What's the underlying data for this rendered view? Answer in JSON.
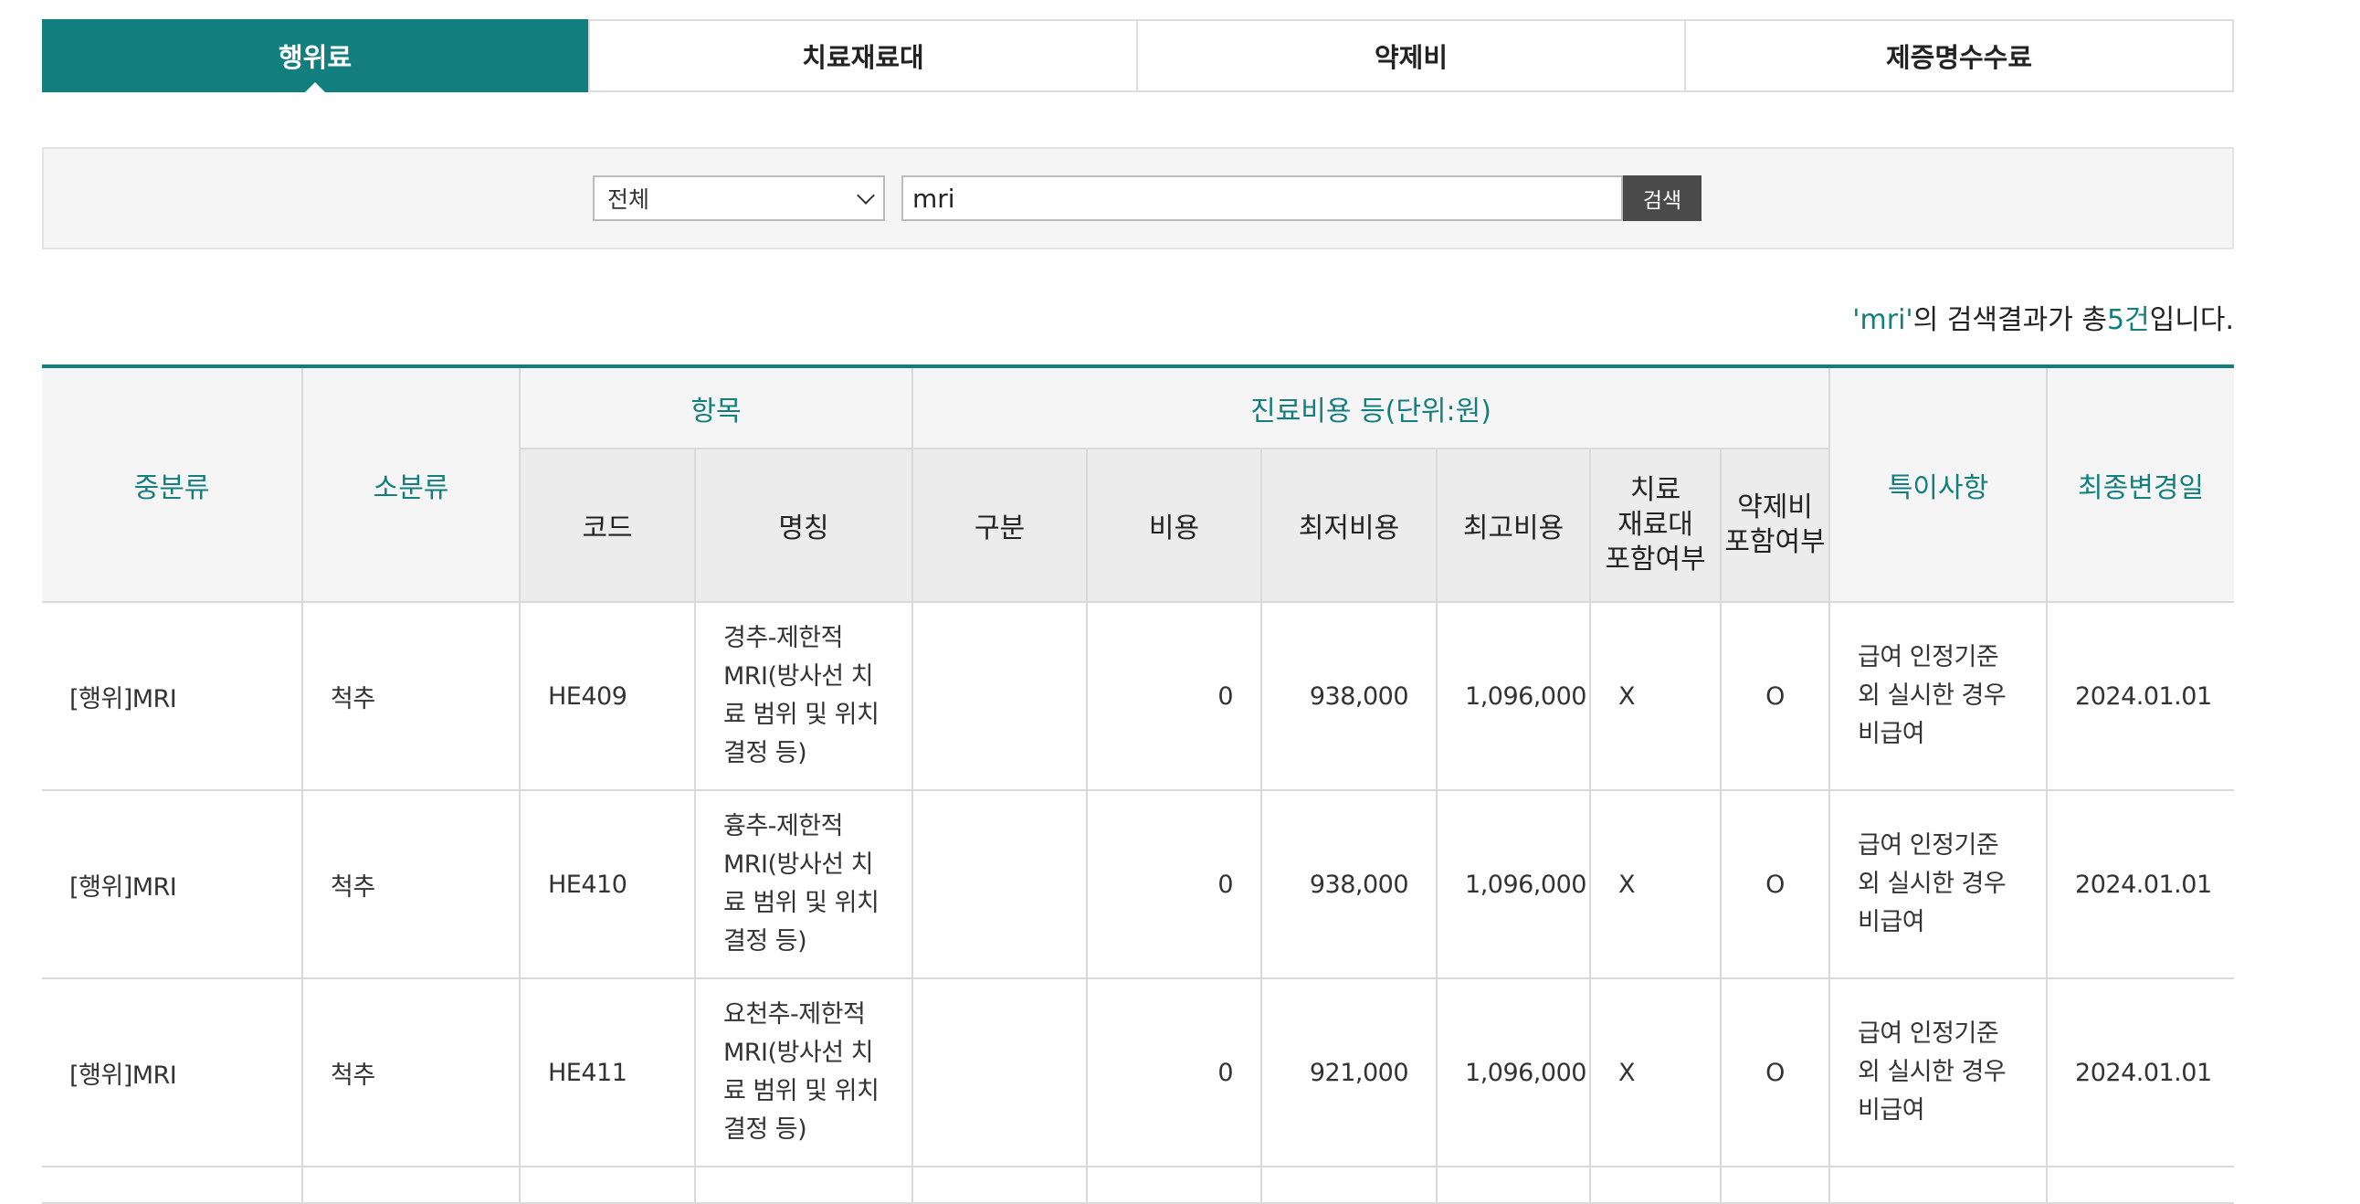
{
  "tabs": [
    {
      "label": "행위료",
      "active": true
    },
    {
      "label": "치료재료대",
      "active": false
    },
    {
      "label": "약제비",
      "active": false
    },
    {
      "label": "제증명수수료",
      "active": false
    }
  ],
  "search": {
    "select_value": "전체",
    "query": "mri",
    "button_label": "검색"
  },
  "summary": {
    "quote_term": "'mri'",
    "text1": "의 검색결과가 총",
    "count": "5건",
    "text2": "입니다."
  },
  "table": {
    "headers": {
      "mid_category": "중분류",
      "sub_category": "소분류",
      "item_group": "항목",
      "cost_group": "진료비용 등(단위:원)",
      "note": "특이사항",
      "last_changed": "최종변경일",
      "code": "코드",
      "name": "명칭",
      "division": "구분",
      "cost": "비용",
      "min_cost": "최저비용",
      "max_cost": "최고비용",
      "material_included": "치료\n재료대\n포함여부",
      "drug_included": "약제비\n포함여부"
    },
    "rows": [
      {
        "mid": "[행위]MRI",
        "sub": "척추",
        "code": "HE409",
        "name": "경추-제한적 MRI(방사선 치료 범위 및 위치결정 등)",
        "division": "",
        "cost": "0",
        "min": "938,000",
        "max": "1,096,000",
        "material": "X",
        "drug": "O",
        "note": "급여 인정기준 외 실시한 경우 비급여",
        "date": "2024.01.01"
      },
      {
        "mid": "[행위]MRI",
        "sub": "척추",
        "code": "HE410",
        "name": "흉추-제한적 MRI(방사선 치료 범위 및 위치결정 등)",
        "division": "",
        "cost": "0",
        "min": "938,000",
        "max": "1,096,000",
        "material": "X",
        "drug": "O",
        "note": "급여 인정기준 외 실시한 경우 비급여",
        "date": "2024.01.01"
      },
      {
        "mid": "[행위]MRI",
        "sub": "척추",
        "code": "HE411",
        "name": "요천추-제한적 MRI(방사선 치료 범위 및 위치결정 등)",
        "division": "",
        "cost": "0",
        "min": "921,000",
        "max": "1,096,000",
        "material": "X",
        "drug": "O",
        "note": "급여 인정기준 외 실시한 경우 비급여",
        "date": "2024.01.01"
      }
    ]
  }
}
